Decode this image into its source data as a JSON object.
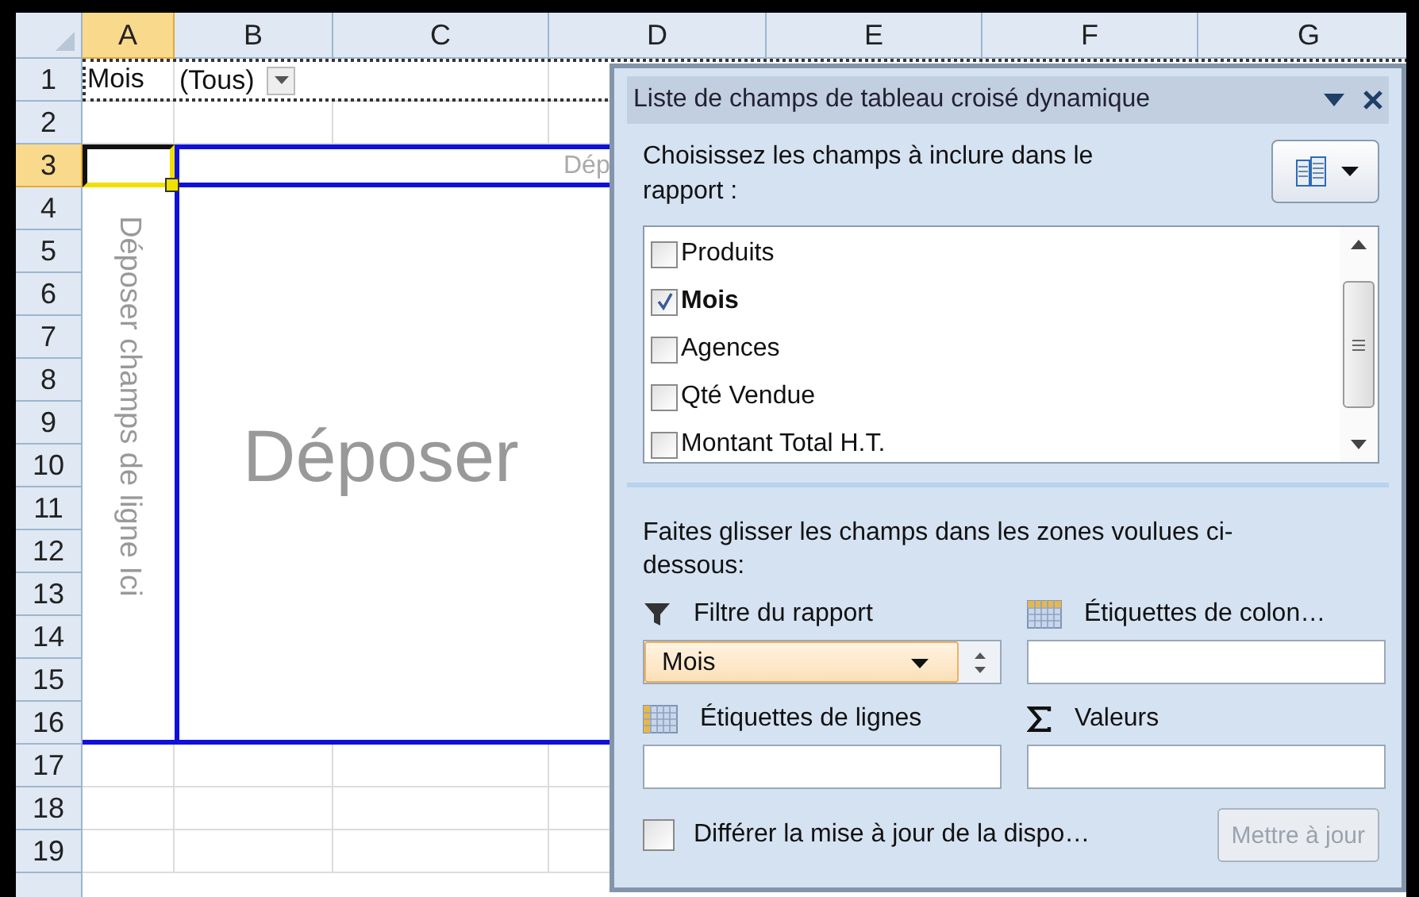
{
  "spreadsheet": {
    "columns": [
      {
        "label": "A",
        "selected": true
      },
      {
        "label": "B",
        "selected": false
      },
      {
        "label": "C",
        "selected": false
      },
      {
        "label": "D",
        "selected": false
      },
      {
        "label": "E",
        "selected": false
      },
      {
        "label": "F",
        "selected": false
      },
      {
        "label": "G",
        "selected": false
      }
    ],
    "rows": [
      {
        "label": "1",
        "selected": false
      },
      {
        "label": "2",
        "selected": false
      },
      {
        "label": "3",
        "selected": true
      },
      {
        "label": "4",
        "selected": false
      },
      {
        "label": "5",
        "selected": false
      },
      {
        "label": "6",
        "selected": false
      },
      {
        "label": "7",
        "selected": false
      },
      {
        "label": "8",
        "selected": false
      },
      {
        "label": "9",
        "selected": false
      },
      {
        "label": "10",
        "selected": false
      },
      {
        "label": "11",
        "selected": false
      },
      {
        "label": "12",
        "selected": false
      },
      {
        "label": "13",
        "selected": false
      },
      {
        "label": "14",
        "selected": false
      },
      {
        "label": "15",
        "selected": false
      },
      {
        "label": "16",
        "selected": false
      },
      {
        "label": "17",
        "selected": false
      },
      {
        "label": "18",
        "selected": false
      },
      {
        "label": "19",
        "selected": false
      }
    ],
    "report_filter": {
      "field": "Mois",
      "value": "(Tous)"
    },
    "pivot_drop_zones": {
      "column_hint": "Dép",
      "row_hint": "Déposer champs de ligne Ici",
      "values_hint": "Déposer"
    }
  },
  "field_list": {
    "title": "Liste de champs de tableau croisé dynamique",
    "instruction": "Choisissez les champs à inclure dans le rapport :",
    "fields": [
      {
        "label": "Produits",
        "checked": false
      },
      {
        "label": "Mois",
        "checked": true
      },
      {
        "label": "Agences",
        "checked": false
      },
      {
        "label": "Qté Vendue",
        "checked": false
      },
      {
        "label": "Montant Total H.T.",
        "checked": false
      }
    ],
    "drag_hint": "Faites glisser les champs dans les zones voulues ci-dessous:",
    "areas": [
      {
        "kind": "filter",
        "label": "Filtre du rapport",
        "items": [
          "Mois"
        ]
      },
      {
        "kind": "columns",
        "label": "Étiquettes de colon…"
      },
      {
        "kind": "rows",
        "label": "Étiquettes de lignes"
      },
      {
        "kind": "values",
        "label": "Valeurs"
      }
    ],
    "defer": {
      "label": "Différer la mise à jour de la dispo…",
      "checked": false
    },
    "update_button": {
      "label": "Mettre à jour",
      "disabled": true
    }
  }
}
